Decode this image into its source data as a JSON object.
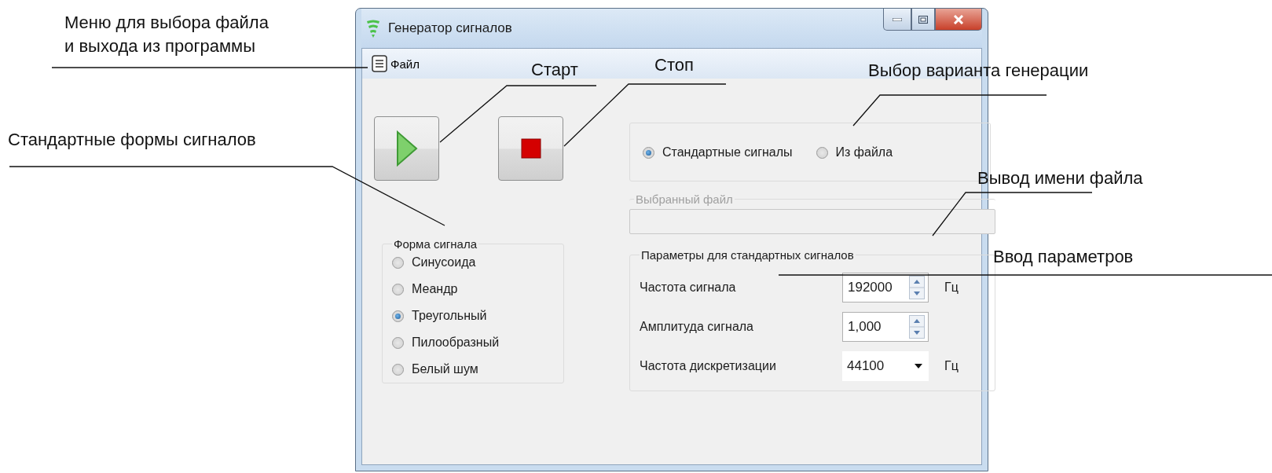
{
  "window": {
    "title": "Генератор сигналов"
  },
  "menu": [
    {
      "label": "Файл"
    }
  ],
  "controls": [
    {
      "kind": "play"
    },
    {
      "kind": "stop"
    }
  ],
  "mode": {
    "options": [
      {
        "label": "Стандартные сигналы",
        "selected": true
      },
      {
        "label": "Из файла",
        "selected": false
      }
    ]
  },
  "file_group": {
    "title": "Выбранный файл",
    "disabled": true
  },
  "waveform": {
    "title": "Форма сигнала",
    "options": [
      {
        "label": "Синусоида",
        "selected": false
      },
      {
        "label": "Меандр",
        "selected": false
      },
      {
        "label": "Треугольный",
        "selected": true
      },
      {
        "label": "Пилообразный",
        "selected": false
      },
      {
        "label": "Белый шум",
        "selected": false
      }
    ]
  },
  "params": {
    "title": "Параметры для стандартных сигналов",
    "fields": [
      {
        "kind": "spin",
        "label": "Частота сигнала",
        "value": "192000",
        "unit": "Гц"
      },
      {
        "kind": "spin",
        "label": "Амплитуда сигнала",
        "value": "1,000"
      },
      {
        "kind": "select",
        "label": "Частота дискретизации",
        "value": "44100",
        "unit": "Гц"
      }
    ]
  },
  "annotations": [
    {
      "text": "Меню для выбора файла\nи выхода из программы"
    },
    {
      "text": "Старт"
    },
    {
      "text": "Стоп"
    },
    {
      "text": "Выбор варианта генерации"
    },
    {
      "text": "Стандартные формы сигналов"
    },
    {
      "text": "Вывод имени файла"
    },
    {
      "text": "Ввод параметров"
    }
  ]
}
